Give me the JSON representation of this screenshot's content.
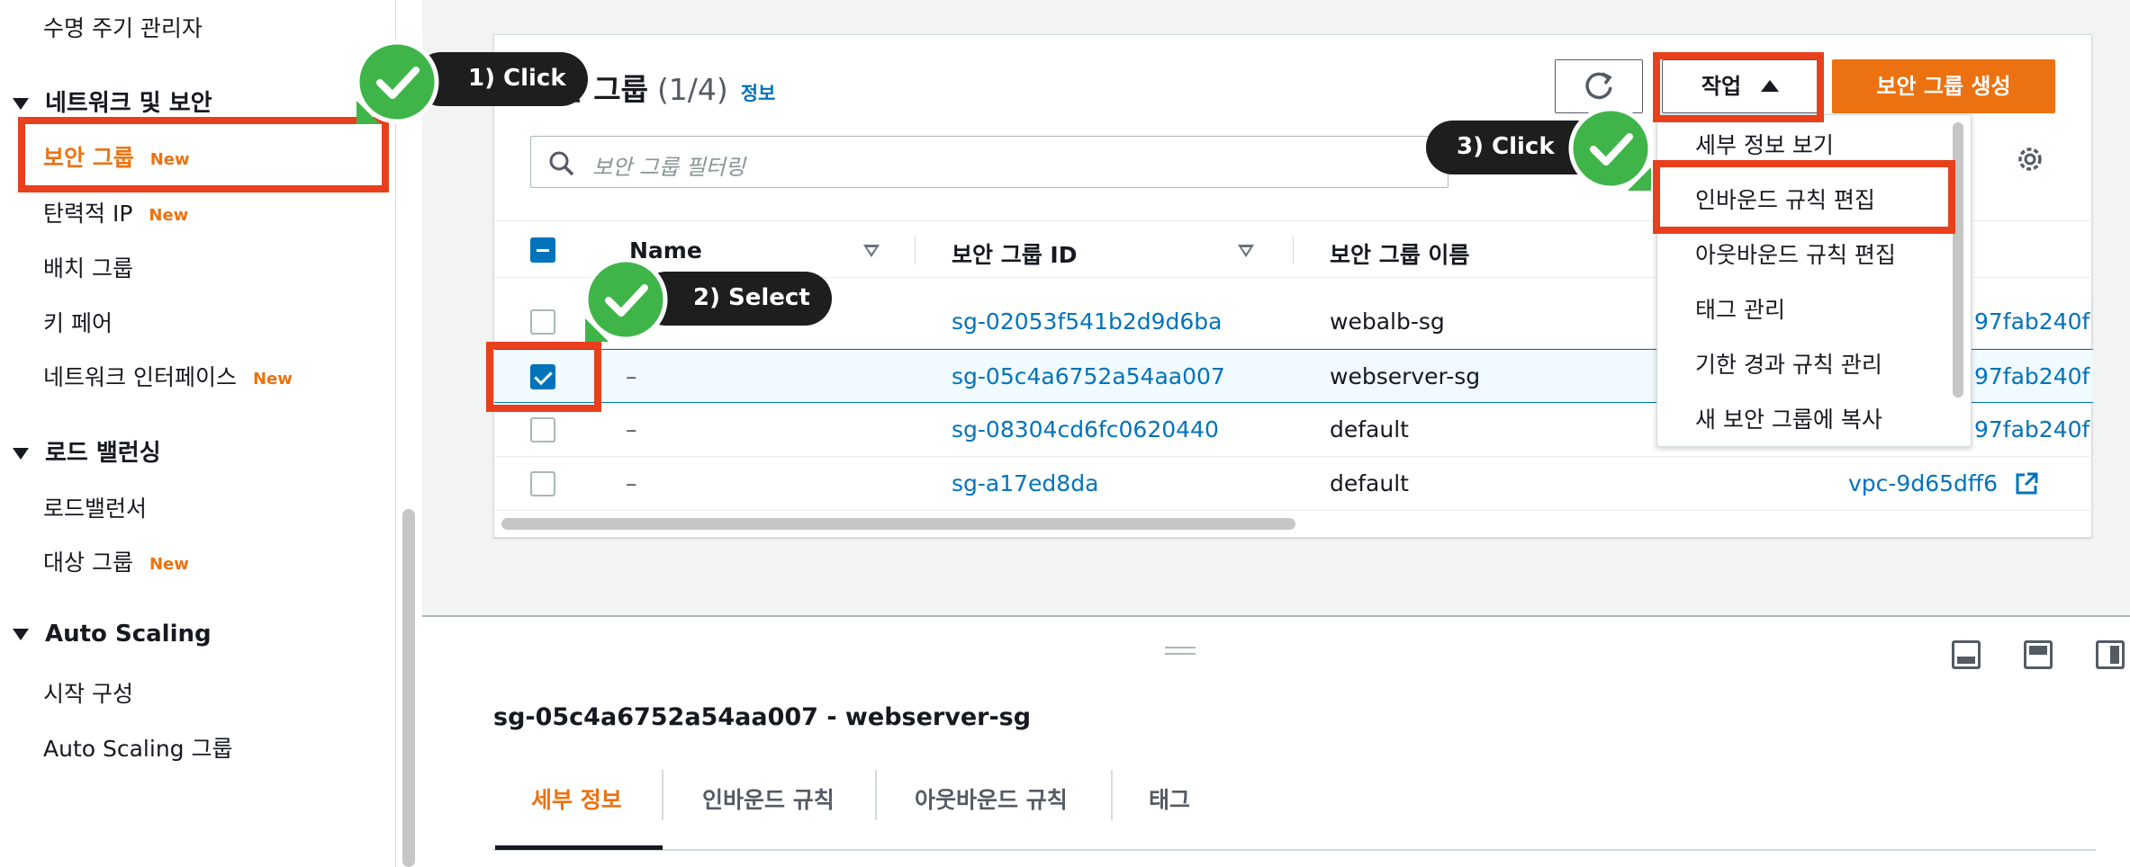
{
  "sidebar": {
    "items_top": [
      {
        "label": "수명 주기 관리자"
      }
    ],
    "network_section": {
      "title": "네트워크 및 보안",
      "items": [
        {
          "label": "보안 그룹",
          "badge": "New",
          "active": true
        },
        {
          "label": "탄력적 IP",
          "badge": "New"
        },
        {
          "label": "배치 그룹"
        },
        {
          "label": "키 페어"
        },
        {
          "label": "네트워크 인터페이스",
          "badge": "New"
        }
      ]
    },
    "lb_section": {
      "title": "로드 밸런싱",
      "items": [
        {
          "label": "로드밸런서"
        },
        {
          "label": "대상 그룹",
          "badge": "New"
        }
      ]
    },
    "as_section": {
      "title": "Auto Scaling",
      "items": [
        {
          "label": "시작 구성"
        },
        {
          "label": "Auto Scaling 그룹"
        }
      ]
    }
  },
  "panel": {
    "title": "보안 그룹",
    "count": "(1/4)",
    "info": "정보",
    "action_label": "작업",
    "create_label": "보안 그룹 생성",
    "search_placeholder": "보안 그룹 필터링",
    "columns": [
      "Name",
      "보안 그룹 ID",
      "보안 그룹 이름"
    ],
    "rows": [
      {
        "name": "",
        "id": "sg-02053f541b2d9d6ba",
        "group_name": "webalb-sg",
        "vpc": "97fab240f",
        "checked": false
      },
      {
        "name": "–",
        "id": "sg-05c4a6752a54aa007",
        "group_name": "webserver-sg",
        "vpc": "97fab240f",
        "checked": true
      },
      {
        "name": "–",
        "id": "sg-08304cd6fc0620440",
        "group_name": "default",
        "vpc": "97fab240f",
        "checked": false
      },
      {
        "name": "–",
        "id": "sg-a17ed8da",
        "group_name": "default",
        "vpc": "vpc-9d65dff6",
        "checked": false
      }
    ]
  },
  "dropdown": {
    "items": [
      "세부 정보 보기",
      "인바운드 규칙 편집",
      "아웃바운드 규칙 편집",
      "태그 관리",
      "기한 경과 규칙 관리",
      "새 보안 그룹에 복사"
    ]
  },
  "detail": {
    "title": "sg-05c4a6752a54aa007 - webserver-sg",
    "tabs": [
      "세부 정보",
      "인바운드 규칙",
      "아웃바운드 규칙",
      "태그"
    ]
  },
  "annotations": {
    "step1": "1) Click",
    "step2": "2) Select",
    "step3": "3) Click",
    "highlight_color": "#e8401c",
    "check_color": "#3fb549"
  },
  "colors": {
    "accent": "#ec7211",
    "link": "#0073bb"
  }
}
